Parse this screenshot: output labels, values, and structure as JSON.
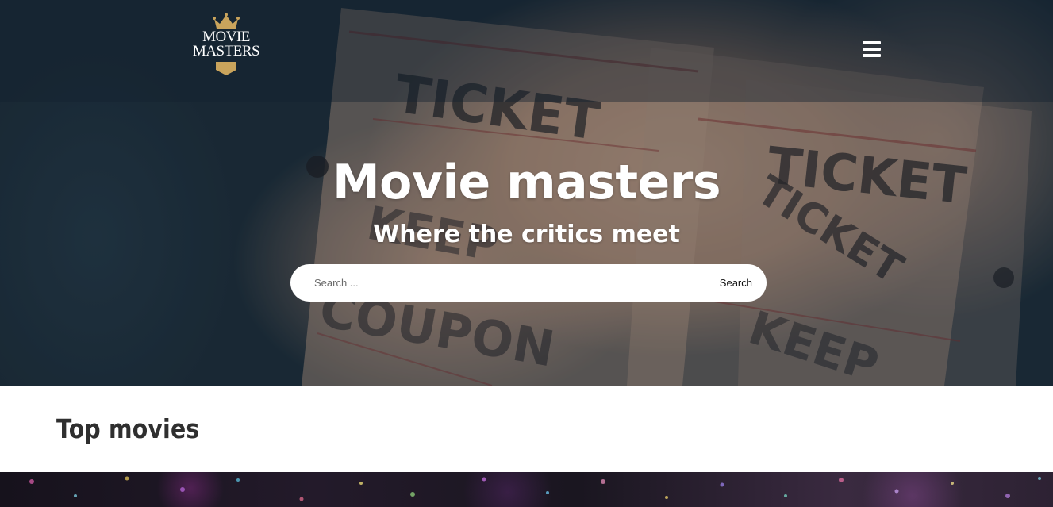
{
  "site": {
    "logo_line1": "MOVIE",
    "logo_line2": "MASTERS",
    "accent_color": "#c9a45c"
  },
  "header": {
    "menu_icon": "hamburger-menu-icon"
  },
  "hero": {
    "title": "Movie masters",
    "subtitle": "Where the critics meet",
    "background_image": "cinema-tickets-photo"
  },
  "search": {
    "placeholder": "Search ...",
    "value": "",
    "button_label": "Search"
  },
  "top_movies": {
    "heading": "Top movies",
    "banner_image": "confetti-photo"
  }
}
